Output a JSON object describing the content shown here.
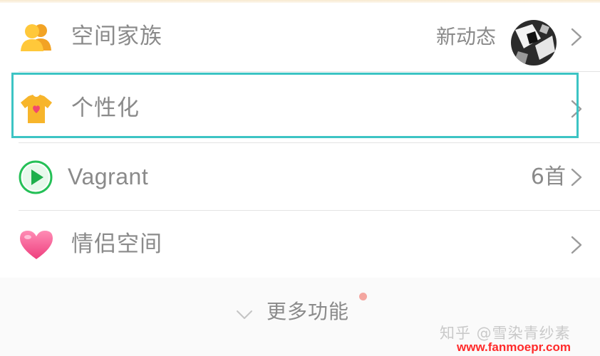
{
  "menu": {
    "items": [
      {
        "label": "空间家族",
        "right_text": "新动态",
        "icon": "family-people-icon",
        "has_avatar": true
      },
      {
        "label": "个性化",
        "right_text": "",
        "icon": "tshirt-heart-icon",
        "highlighted": true
      },
      {
        "label": "Vagrant",
        "right_text": "6首",
        "icon": "play-circle-icon"
      },
      {
        "label": "情侣空间",
        "right_text": "",
        "icon": "heart-icon"
      }
    ]
  },
  "more": {
    "label": "更多功能",
    "icon": "chevron-down-icon",
    "has_badge_dot": true
  },
  "watermark": {
    "author": "知乎 @雪染青纱素",
    "url": "www.fanmoepr.com"
  },
  "colors": {
    "text_gray": "#8a8a8a",
    "highlight_border": "#3cc4c4",
    "play_green": "#25c057",
    "heart_pink": "#f3588f",
    "icon_orange": "#f6a51d",
    "watermark_red": "#ff2a2a"
  }
}
